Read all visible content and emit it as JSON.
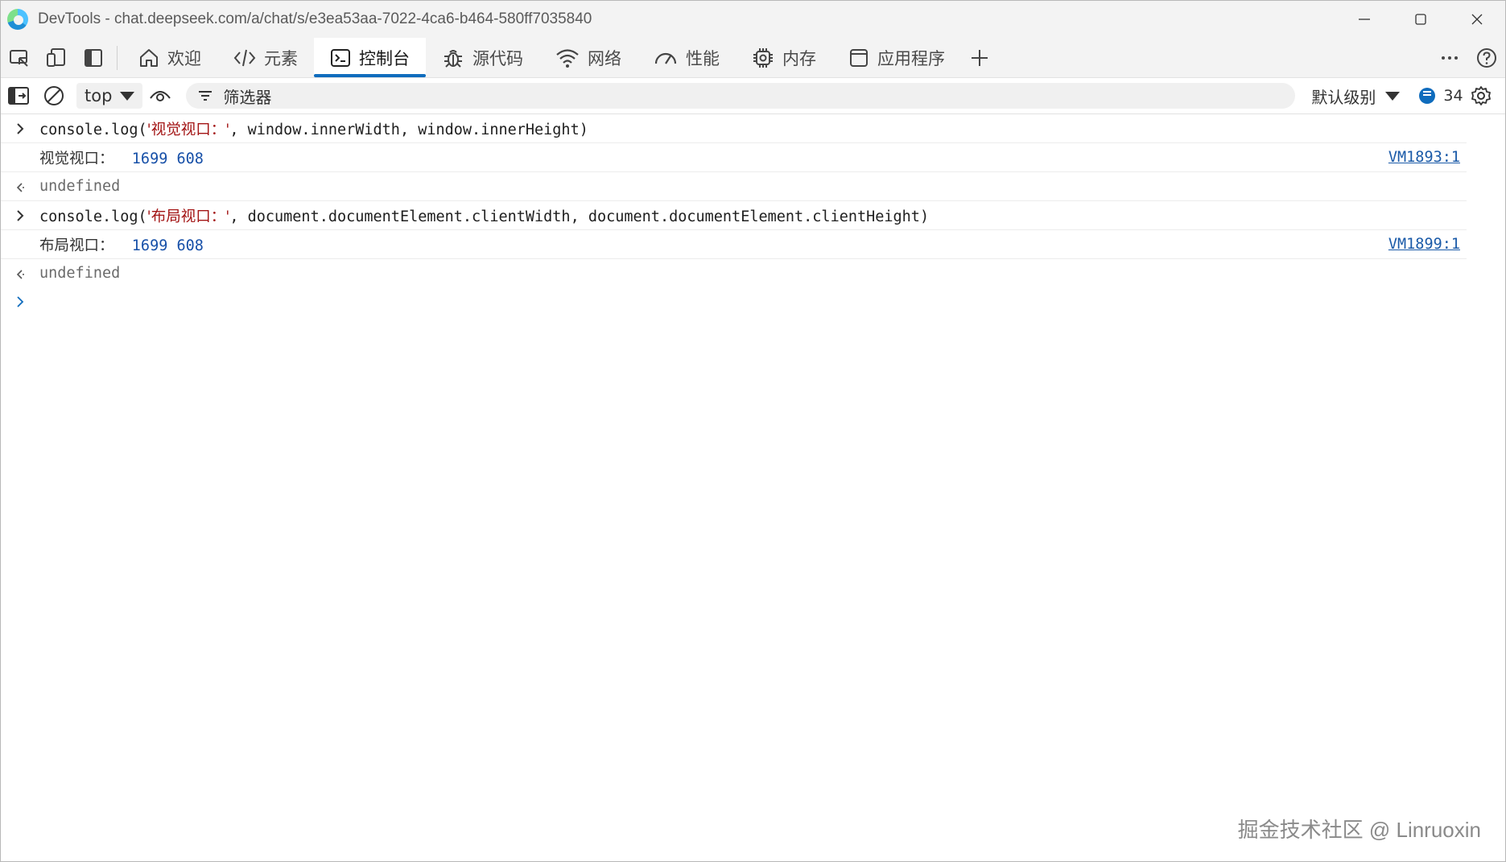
{
  "window": {
    "title": "DevTools - chat.deepseek.com/a/chat/s/e3ea53aa-7022-4ca6-b464-580ff7035840",
    "icon": "edge-icon"
  },
  "tabs": [
    {
      "label": "欢迎",
      "icon": "home-icon"
    },
    {
      "label": "元素",
      "icon": "code-icon"
    },
    {
      "label": "控制台",
      "icon": "console-icon",
      "active": true
    },
    {
      "label": "源代码",
      "icon": "bug-icon"
    },
    {
      "label": "网络",
      "icon": "wifi-icon"
    },
    {
      "label": "性能",
      "icon": "gauge-icon"
    },
    {
      "label": "内存",
      "icon": "chip-icon"
    },
    {
      "label": "应用程序",
      "icon": "app-icon"
    }
  ],
  "toolbar": {
    "context": "top",
    "filter_placeholder": "筛选器",
    "levels": "默认级别",
    "message_count": "34"
  },
  "console": {
    "entries": [
      {
        "kind": "input",
        "prefix": "console.log(",
        "str": "'视觉视口：'",
        "suffix": ", window.innerWidth, window.innerHeight)"
      },
      {
        "kind": "log",
        "label": "视觉视口：",
        "value": "1699 608",
        "source": "VM1893:1"
      },
      {
        "kind": "result",
        "text": "undefined"
      },
      {
        "kind": "input",
        "prefix": "console.log(",
        "str": "'布局视口：'",
        "suffix": ", document.documentElement.clientWidth, document.documentElement.clientHeight)"
      },
      {
        "kind": "log",
        "label": "布局视口：",
        "value": "1699 608",
        "source": "VM1899:1"
      },
      {
        "kind": "result",
        "text": "undefined"
      }
    ]
  },
  "watermark": "掘金技术社区 @ Linruoxin",
  "colors": {
    "accent": "#0f6cbd",
    "string": "#a31515",
    "number": "#1750a8"
  }
}
